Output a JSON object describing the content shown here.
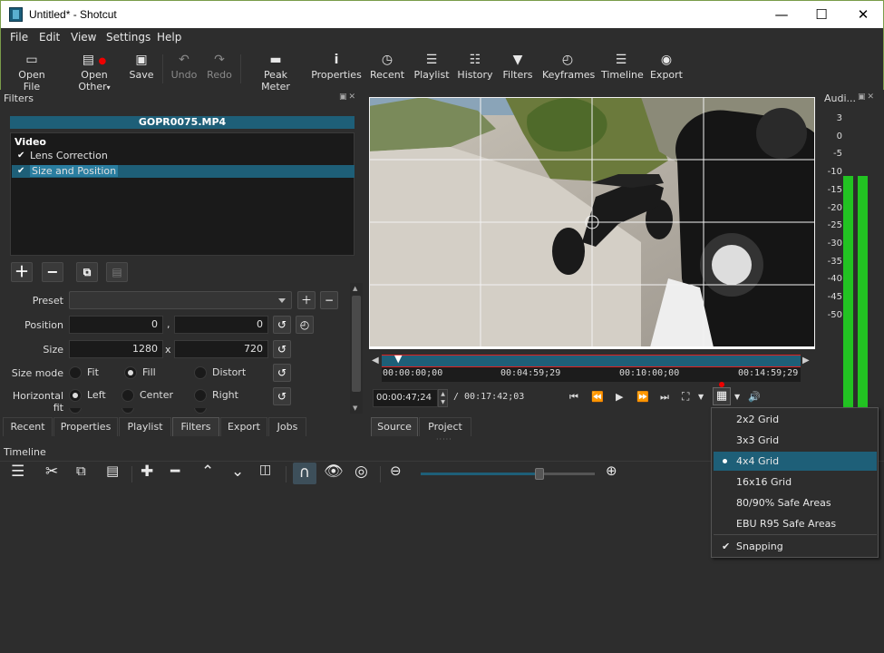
{
  "window": {
    "title": "Untitled* - Shotcut",
    "minimize": "—",
    "maximize": "☐",
    "close": "✕"
  },
  "menu": [
    "File",
    "Edit",
    "View",
    "Settings",
    "Help"
  ],
  "toolbar": [
    {
      "label": "Open File",
      "icon": "open-file-icon",
      "glyph": "▭"
    },
    {
      "label": "Open Other",
      "icon": "open-other-icon",
      "glyph": "▼"
    },
    {
      "label": "Save",
      "icon": "save-icon",
      "glyph": "🖫"
    },
    {
      "label": "Undo",
      "icon": "undo-icon",
      "glyph": "↶",
      "disabled": true
    },
    {
      "label": "Redo",
      "icon": "redo-icon",
      "glyph": "↷",
      "disabled": true
    },
    {
      "label": "Peak Meter",
      "icon": "peak-meter-icon",
      "glyph": "▬"
    },
    {
      "label": "Properties",
      "icon": "properties-icon",
      "glyph": "ⅰ"
    },
    {
      "label": "Recent",
      "icon": "recent-icon",
      "glyph": "◷"
    },
    {
      "label": "Playlist",
      "icon": "playlist-icon",
      "glyph": "☰"
    },
    {
      "label": "History",
      "icon": "history-icon",
      "glyph": "☷"
    },
    {
      "label": "Filters",
      "icon": "filters-icon",
      "glyph": "▼"
    },
    {
      "label": "Keyframes",
      "icon": "keyframes-icon",
      "glyph": "◴"
    },
    {
      "label": "Timeline",
      "icon": "timeline-icon",
      "glyph": "☰"
    },
    {
      "label": "Export",
      "icon": "export-icon",
      "glyph": "◉"
    }
  ],
  "filters_panel": {
    "title": "Filters",
    "clip_name": "GOPR0075.MP4",
    "category": "Video",
    "items": [
      {
        "label": "Lens Correction",
        "checked": true,
        "selected": false
      },
      {
        "label": "Size and Position",
        "checked": true,
        "selected": true
      }
    ],
    "preset_label": "Preset",
    "position_label": "Position",
    "position_x": "0",
    "position_y": "0",
    "position_sep": ",",
    "size_label": "Size",
    "size_w": "1280",
    "size_h": "720",
    "size_sep": "x",
    "size_mode_label": "Size mode",
    "size_mode_options": [
      "Fit",
      "Fill",
      "Distort"
    ],
    "size_mode_selected": "Fill",
    "hfit_label": "Horizontal fit",
    "hfit_options": [
      "Left",
      "Center",
      "Right"
    ],
    "hfit_selected": "Left"
  },
  "left_tabs": [
    "Recent",
    "Properties",
    "Playlist",
    "Filters",
    "Export",
    "Jobs"
  ],
  "left_tabs_active": "Filters",
  "player": {
    "ruler_labels": [
      "00:00:00;00",
      "00:04:59;29",
      "00:10:00;00",
      "00:14:59;29"
    ],
    "current_time": "00:00:47;24",
    "total_time": "/ 00:17:42;03",
    "tabs": [
      "Source",
      "Project"
    ],
    "tabs_active": "Source"
  },
  "audio_meter": {
    "title": "Audi...",
    "scale": [
      "3",
      "0",
      "-5",
      "-10",
      "-15",
      "-20",
      "-25",
      "-30",
      "-35",
      "-40",
      "-45",
      "-50"
    ],
    "level_left_db": -10,
    "level_right_db": -10
  },
  "timeline": {
    "title": "Timeline",
    "zoom": 0.68
  },
  "grid_menu": {
    "items": [
      "2x2 Grid",
      "3x3 Grid",
      "4x4 Grid",
      "16x16 Grid",
      "80/90% Safe Areas",
      "EBU R95 Safe Areas"
    ],
    "selected": "4x4 Grid",
    "snapping": "Snapping",
    "snapping_checked": true
  },
  "colors": {
    "accent": "#1e5f78",
    "meter": "#22c322",
    "playhead": "#e02020"
  }
}
